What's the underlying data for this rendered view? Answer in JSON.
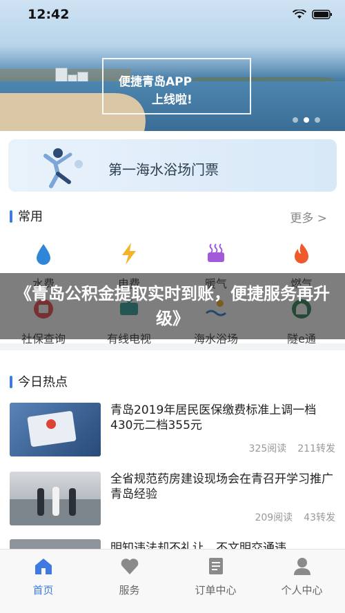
{
  "status_bar": {
    "time": "12:42"
  },
  "banner": {
    "line1": "便捷青岛APP",
    "line2": "上线啦!"
  },
  "promo": {
    "title": "第一海水浴场门票"
  },
  "common": {
    "title": "常用",
    "more": "更多 >",
    "items": [
      {
        "label": "水费",
        "icon": "water-drop-icon"
      },
      {
        "label": "电费",
        "icon": "lightning-icon"
      },
      {
        "label": "暖气",
        "icon": "heater-icon"
      },
      {
        "label": "燃气",
        "icon": "flame-icon"
      },
      {
        "label": "社保查询",
        "icon": "social-security-icon"
      },
      {
        "label": "有线电视",
        "icon": "tv-icon"
      },
      {
        "label": "海水浴场",
        "icon": "beach-icon"
      },
      {
        "label": "隧e通",
        "icon": "tunnel-icon"
      }
    ]
  },
  "overlay": {
    "text": "《青岛公积金提取实时到账，便捷服务再升级》"
  },
  "hot": {
    "title": "今日热点",
    "items": [
      {
        "title": "青岛2019年居民医保缴费标准上调一档430元二档355元",
        "reads": "325阅读",
        "shares": "211转发"
      },
      {
        "title": "全省规范药房建设现场会在青召开学习推广青岛经验",
        "reads": "209阅读",
        "shares": "43转发"
      },
      {
        "title": "明知违法却不礼让，不文明交通违",
        "reads": "",
        "shares": ""
      }
    ]
  },
  "tabbar": {
    "items": [
      {
        "label": "首页",
        "icon": "home-icon"
      },
      {
        "label": "服务",
        "icon": "heart-icon"
      },
      {
        "label": "订单中心",
        "icon": "order-icon"
      },
      {
        "label": "个人中心",
        "icon": "person-icon"
      }
    ]
  },
  "colors": {
    "accent": "#3d7be2",
    "water": "#2f86d8",
    "lightning": "#f3b32a",
    "heater": "#a259d9",
    "flame": "#ef5a2a"
  }
}
